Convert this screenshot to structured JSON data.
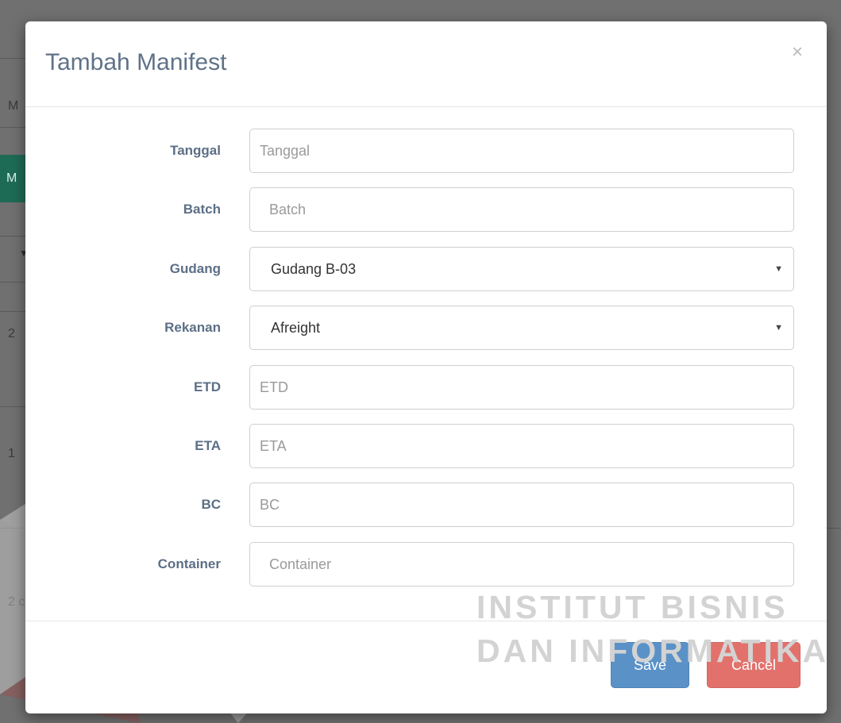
{
  "modal": {
    "title": "Tambah Manifest",
    "close_symbol": "×",
    "fields": {
      "tanggal": {
        "label": "Tanggal",
        "placeholder": "Tanggal",
        "value": ""
      },
      "batch": {
        "label": "Batch",
        "placeholder": "Batch",
        "value": ""
      },
      "gudang": {
        "label": "Gudang",
        "selected": "Gudang B-03"
      },
      "rekanan": {
        "label": "Rekanan",
        "selected": "Afreight"
      },
      "etd": {
        "label": "ETD",
        "placeholder": "ETD",
        "value": ""
      },
      "eta": {
        "label": "ETA",
        "placeholder": "ETA",
        "value": ""
      },
      "bc": {
        "label": "BC",
        "placeholder": "BC",
        "value": ""
      },
      "container": {
        "label": "Container",
        "placeholder": "Container",
        "value": ""
      }
    },
    "buttons": {
      "save": "Save",
      "cancel": "Cancel"
    }
  },
  "background": {
    "fragments": [
      "M",
      "M",
      "2",
      "1",
      "2 c"
    ],
    "caret": "▼"
  },
  "watermark": {
    "line1": "INSTITUT BISNIS",
    "line2": "DAN INFORMATIKA"
  },
  "colors": {
    "label": "#5c6f86",
    "title": "#5f7287",
    "save": "#5a92c8",
    "cancel": "#e2716c",
    "accent_green": "#1e6b55"
  }
}
